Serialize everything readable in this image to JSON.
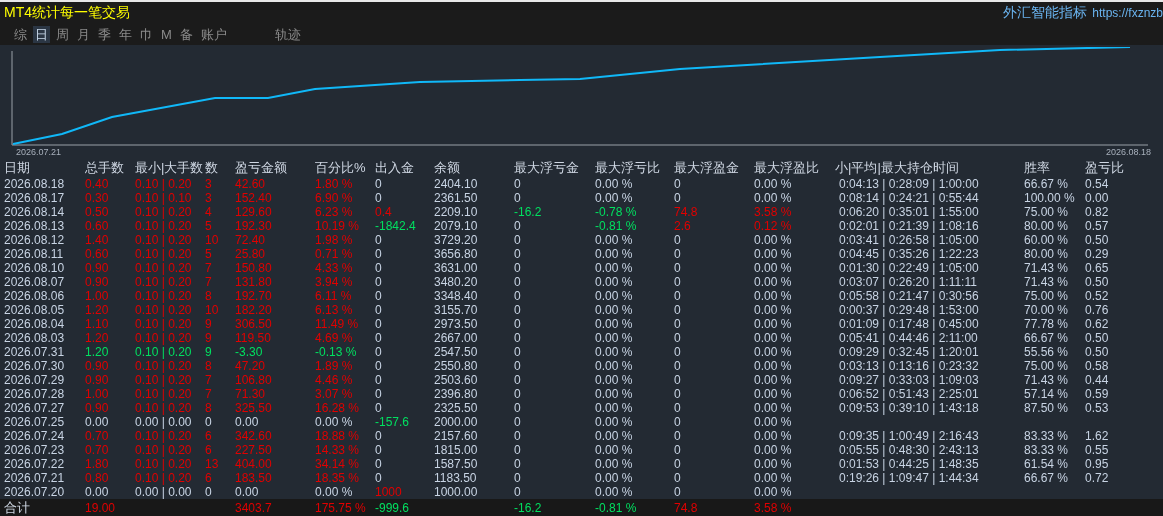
{
  "title": "MT4统计每一笔交易",
  "brand": {
    "name": "外汇智能指标",
    "url": "https://fxznzb"
  },
  "tabs": [
    {
      "label": "综",
      "selected": false
    },
    {
      "label": "日",
      "selected": true
    },
    {
      "label": "周",
      "selected": false
    },
    {
      "label": "月",
      "selected": false
    },
    {
      "label": "季",
      "selected": false
    },
    {
      "label": "年",
      "selected": false
    },
    {
      "label": "巾",
      "selected": false
    },
    {
      "label": "M",
      "selected": false
    },
    {
      "label": "备",
      "selected": false
    },
    {
      "label": "账户",
      "selected": false
    },
    {
      "label": "轨迹",
      "selected": false
    }
  ],
  "chart": {
    "start_label": "2026.07.21",
    "end_label": "2026.08.18"
  },
  "table": {
    "columns": [
      "日期",
      "总手数",
      "最小|大手数",
      "数",
      "盈亏金额",
      "百分比%",
      "出入金",
      "余额",
      "最大浮亏金",
      "最大浮亏比",
      "最大浮盈金",
      "最大浮盈比",
      "小|平均|最大持仓时间",
      "胜率",
      "盈亏比"
    ],
    "rows": [
      {
        "date": "2026.08.18",
        "color": "#e00000",
        "lots": "0.40",
        "lot_range": "0.10 | 0.20",
        "count": "3",
        "profit": "42.60",
        "percent": "1.80 %",
        "cash_flow": {
          "text": "0",
          "color": "#c8d4e4"
        },
        "balance": "2404.10",
        "float_loss": {
          "text": "0",
          "color": "#c8d4e4"
        },
        "float_loss_pct": {
          "text": "0.00 %",
          "color": "#c8d4e4"
        },
        "float_profit": {
          "text": "0",
          "color": "#c8d4e4"
        },
        "float_profit_pct": {
          "text": "0.00 %",
          "color": "#c8d4e4"
        },
        "hold_time": "0:04:13 | 0:28:09 | 1:00:00",
        "win_rate": "66.67 %",
        "pl_ratio": "0.54"
      },
      {
        "date": "2026.08.17",
        "color": "#e00000",
        "lots": "0.30",
        "lot_range": "0.10 | 0.10",
        "count": "3",
        "profit": "152.40",
        "percent": "6.90 %",
        "cash_flow": {
          "text": "0",
          "color": "#c8d4e4"
        },
        "balance": "2361.50",
        "float_loss": {
          "text": "0",
          "color": "#c8d4e4"
        },
        "float_loss_pct": {
          "text": "0.00 %",
          "color": "#c8d4e4"
        },
        "float_profit": {
          "text": "0",
          "color": "#c8d4e4"
        },
        "float_profit_pct": {
          "text": "0.00 %",
          "color": "#c8d4e4"
        },
        "hold_time": "0:08:14 | 0:24:21 | 0:55:44",
        "win_rate": "100.00 %",
        "pl_ratio": "0.00"
      },
      {
        "date": "2026.08.14",
        "color": "#e00000",
        "lots": "0.50",
        "lot_range": "0.10 | 0.20",
        "count": "4",
        "profit": "129.60",
        "percent": "6.23 %",
        "cash_flow": {
          "text": "0.4",
          "color": "#e00000"
        },
        "balance": "2209.10",
        "float_loss": {
          "text": "-16.2",
          "color": "#00e060"
        },
        "float_loss_pct": {
          "text": "-0.78 %",
          "color": "#00e060"
        },
        "float_profit": {
          "text": "74.8",
          "color": "#e00000"
        },
        "float_profit_pct": {
          "text": "3.58 %",
          "color": "#e00000"
        },
        "hold_time": "0:06:20 | 0:35:01 | 1:55:00",
        "win_rate": "75.00 %",
        "pl_ratio": "0.82"
      },
      {
        "date": "2026.08.13",
        "color": "#e00000",
        "lots": "0.60",
        "lot_range": "0.10 | 0.20",
        "count": "5",
        "profit": "192.30",
        "percent": "10.19 %",
        "cash_flow": {
          "text": "-1842.4",
          "color": "#00e060"
        },
        "balance": "2079.10",
        "float_loss": {
          "text": "0",
          "color": "#c8d4e4"
        },
        "float_loss_pct": {
          "text": "-0.81 %",
          "color": "#00e060"
        },
        "float_profit": {
          "text": "2.6",
          "color": "#e00000"
        },
        "float_profit_pct": {
          "text": "0.12 %",
          "color": "#e00000"
        },
        "hold_time": "0:02:01 | 0:21:39 | 1:08:16",
        "win_rate": "80.00 %",
        "pl_ratio": "0.57"
      },
      {
        "date": "2026.08.12",
        "color": "#e00000",
        "lots": "1.40",
        "lot_range": "0.10 | 0.20",
        "count": "10",
        "profit": "72.40",
        "percent": "1.98 %",
        "cash_flow": {
          "text": "0",
          "color": "#c8d4e4"
        },
        "balance": "3729.20",
        "float_loss": {
          "text": "0",
          "color": "#c8d4e4"
        },
        "float_loss_pct": {
          "text": "0.00 %",
          "color": "#c8d4e4"
        },
        "float_profit": {
          "text": "0",
          "color": "#c8d4e4"
        },
        "float_profit_pct": {
          "text": "0.00 %",
          "color": "#c8d4e4"
        },
        "hold_time": "0:03:41 | 0:26:58 | 1:05:00",
        "win_rate": "60.00 %",
        "pl_ratio": "0.50"
      },
      {
        "date": "2026.08.11",
        "color": "#e00000",
        "lots": "0.60",
        "lot_range": "0.10 | 0.20",
        "count": "5",
        "profit": "25.80",
        "percent": "0.71 %",
        "cash_flow": {
          "text": "0",
          "color": "#c8d4e4"
        },
        "balance": "3656.80",
        "float_loss": {
          "text": "0",
          "color": "#c8d4e4"
        },
        "float_loss_pct": {
          "text": "0.00 %",
          "color": "#c8d4e4"
        },
        "float_profit": {
          "text": "0",
          "color": "#c8d4e4"
        },
        "float_profit_pct": {
          "text": "0.00 %",
          "color": "#c8d4e4"
        },
        "hold_time": "0:04:45 | 0:35:26 | 1:22:23",
        "win_rate": "80.00 %",
        "pl_ratio": "0.29"
      },
      {
        "date": "2026.08.10",
        "color": "#e00000",
        "lots": "0.90",
        "lot_range": "0.10 | 0.20",
        "count": "7",
        "profit": "150.80",
        "percent": "4.33 %",
        "cash_flow": {
          "text": "0",
          "color": "#c8d4e4"
        },
        "balance": "3631.00",
        "float_loss": {
          "text": "0",
          "color": "#c8d4e4"
        },
        "float_loss_pct": {
          "text": "0.00 %",
          "color": "#c8d4e4"
        },
        "float_profit": {
          "text": "0",
          "color": "#c8d4e4"
        },
        "float_profit_pct": {
          "text": "0.00 %",
          "color": "#c8d4e4"
        },
        "hold_time": "0:01:30 | 0:22:49 | 1:05:00",
        "win_rate": "71.43 %",
        "pl_ratio": "0.65"
      },
      {
        "date": "2026.08.07",
        "color": "#e00000",
        "lots": "0.90",
        "lot_range": "0.10 | 0.20",
        "count": "7",
        "profit": "131.80",
        "percent": "3.94 %",
        "cash_flow": {
          "text": "0",
          "color": "#c8d4e4"
        },
        "balance": "3480.20",
        "float_loss": {
          "text": "0",
          "color": "#c8d4e4"
        },
        "float_loss_pct": {
          "text": "0.00 %",
          "color": "#c8d4e4"
        },
        "float_profit": {
          "text": "0",
          "color": "#c8d4e4"
        },
        "float_profit_pct": {
          "text": "0.00 %",
          "color": "#c8d4e4"
        },
        "hold_time": "0:03:07 | 0:26:20 | 1:11:11",
        "win_rate": "71.43 %",
        "pl_ratio": "0.50"
      },
      {
        "date": "2026.08.06",
        "color": "#e00000",
        "lots": "1.00",
        "lot_range": "0.10 | 0.20",
        "count": "8",
        "profit": "192.70",
        "percent": "6.11 %",
        "cash_flow": {
          "text": "0",
          "color": "#c8d4e4"
        },
        "balance": "3348.40",
        "float_loss": {
          "text": "0",
          "color": "#c8d4e4"
        },
        "float_loss_pct": {
          "text": "0.00 %",
          "color": "#c8d4e4"
        },
        "float_profit": {
          "text": "0",
          "color": "#c8d4e4"
        },
        "float_profit_pct": {
          "text": "0.00 %",
          "color": "#c8d4e4"
        },
        "hold_time": "0:05:58 | 0:21:47 | 0:30:56",
        "win_rate": "75.00 %",
        "pl_ratio": "0.52"
      },
      {
        "date": "2026.08.05",
        "color": "#e00000",
        "lots": "1.20",
        "lot_range": "0.10 | 0.20",
        "count": "10",
        "profit": "182.20",
        "percent": "6.13 %",
        "cash_flow": {
          "text": "0",
          "color": "#c8d4e4"
        },
        "balance": "3155.70",
        "float_loss": {
          "text": "0",
          "color": "#c8d4e4"
        },
        "float_loss_pct": {
          "text": "0.00 %",
          "color": "#c8d4e4"
        },
        "float_profit": {
          "text": "0",
          "color": "#c8d4e4"
        },
        "float_profit_pct": {
          "text": "0.00 %",
          "color": "#c8d4e4"
        },
        "hold_time": "0:00:37 | 0:29:48 | 1:53:00",
        "win_rate": "70.00 %",
        "pl_ratio": "0.76"
      },
      {
        "date": "2026.08.04",
        "color": "#e00000",
        "lots": "1.10",
        "lot_range": "0.10 | 0.20",
        "count": "9",
        "profit": "306.50",
        "percent": "11.49 %",
        "cash_flow": {
          "text": "0",
          "color": "#c8d4e4"
        },
        "balance": "2973.50",
        "float_loss": {
          "text": "0",
          "color": "#c8d4e4"
        },
        "float_loss_pct": {
          "text": "0.00 %",
          "color": "#c8d4e4"
        },
        "float_profit": {
          "text": "0",
          "color": "#c8d4e4"
        },
        "float_profit_pct": {
          "text": "0.00 %",
          "color": "#c8d4e4"
        },
        "hold_time": "0:01:09 | 0:17:48 | 0:45:00",
        "win_rate": "77.78 %",
        "pl_ratio": "0.62"
      },
      {
        "date": "2026.08.03",
        "color": "#e00000",
        "lots": "1.20",
        "lot_range": "0.10 | 0.20",
        "count": "9",
        "profit": "119.50",
        "percent": "4.69 %",
        "cash_flow": {
          "text": "0",
          "color": "#c8d4e4"
        },
        "balance": "2667.00",
        "float_loss": {
          "text": "0",
          "color": "#c8d4e4"
        },
        "float_loss_pct": {
          "text": "0.00 %",
          "color": "#c8d4e4"
        },
        "float_profit": {
          "text": "0",
          "color": "#c8d4e4"
        },
        "float_profit_pct": {
          "text": "0.00 %",
          "color": "#c8d4e4"
        },
        "hold_time": "0:05:41 | 0:44:46 | 2:11:00",
        "win_rate": "66.67 %",
        "pl_ratio": "0.50"
      },
      {
        "date": "2026.07.31",
        "color": "#00e060",
        "lots": "1.20",
        "lot_range": "0.10 | 0.20",
        "count": "9",
        "profit": "-3.30",
        "percent": "-0.13 %",
        "cash_flow": {
          "text": "0",
          "color": "#c8d4e4"
        },
        "balance": "2547.50",
        "float_loss": {
          "text": "0",
          "color": "#c8d4e4"
        },
        "float_loss_pct": {
          "text": "0.00 %",
          "color": "#c8d4e4"
        },
        "float_profit": {
          "text": "0",
          "color": "#c8d4e4"
        },
        "float_profit_pct": {
          "text": "0.00 %",
          "color": "#c8d4e4"
        },
        "hold_time": "0:09:29 | 0:32:45 | 1:20:01",
        "win_rate": "55.56 %",
        "pl_ratio": "0.50"
      },
      {
        "date": "2026.07.30",
        "color": "#e00000",
        "lots": "0.90",
        "lot_range": "0.10 | 0.20",
        "count": "8",
        "profit": "47.20",
        "percent": "1.89 %",
        "cash_flow": {
          "text": "0",
          "color": "#c8d4e4"
        },
        "balance": "2550.80",
        "float_loss": {
          "text": "0",
          "color": "#c8d4e4"
        },
        "float_loss_pct": {
          "text": "0.00 %",
          "color": "#c8d4e4"
        },
        "float_profit": {
          "text": "0",
          "color": "#c8d4e4"
        },
        "float_profit_pct": {
          "text": "0.00 %",
          "color": "#c8d4e4"
        },
        "hold_time": "0:03:13 | 0:13:16 | 0:23:32",
        "win_rate": "75.00 %",
        "pl_ratio": "0.58"
      },
      {
        "date": "2026.07.29",
        "color": "#e00000",
        "lots": "0.90",
        "lot_range": "0.10 | 0.20",
        "count": "7",
        "profit": "106.80",
        "percent": "4.46 %",
        "cash_flow": {
          "text": "0",
          "color": "#c8d4e4"
        },
        "balance": "2503.60",
        "float_loss": {
          "text": "0",
          "color": "#c8d4e4"
        },
        "float_loss_pct": {
          "text": "0.00 %",
          "color": "#c8d4e4"
        },
        "float_profit": {
          "text": "0",
          "color": "#c8d4e4"
        },
        "float_profit_pct": {
          "text": "0.00 %",
          "color": "#c8d4e4"
        },
        "hold_time": "0:09:27 | 0:33:03 | 1:09:03",
        "win_rate": "71.43 %",
        "pl_ratio": "0.44"
      },
      {
        "date": "2026.07.28",
        "color": "#e00000",
        "lots": "1.00",
        "lot_range": "0.10 | 0.20",
        "count": "7",
        "profit": "71.30",
        "percent": "3.07 %",
        "cash_flow": {
          "text": "0",
          "color": "#c8d4e4"
        },
        "balance": "2396.80",
        "float_loss": {
          "text": "0",
          "color": "#c8d4e4"
        },
        "float_loss_pct": {
          "text": "0.00 %",
          "color": "#c8d4e4"
        },
        "float_profit": {
          "text": "0",
          "color": "#c8d4e4"
        },
        "float_profit_pct": {
          "text": "0.00 %",
          "color": "#c8d4e4"
        },
        "hold_time": "0:06:52 | 0:51:43 | 2:25:01",
        "win_rate": "57.14 %",
        "pl_ratio": "0.59"
      },
      {
        "date": "2026.07.27",
        "color": "#e00000",
        "lots": "0.90",
        "lot_range": "0.10 | 0.20",
        "count": "8",
        "profit": "325.50",
        "percent": "16.28 %",
        "cash_flow": {
          "text": "0",
          "color": "#c8d4e4"
        },
        "balance": "2325.50",
        "float_loss": {
          "text": "0",
          "color": "#c8d4e4"
        },
        "float_loss_pct": {
          "text": "0.00 %",
          "color": "#c8d4e4"
        },
        "float_profit": {
          "text": "0",
          "color": "#c8d4e4"
        },
        "float_profit_pct": {
          "text": "0.00 %",
          "color": "#c8d4e4"
        },
        "hold_time": "0:09:53 | 0:39:10 | 1:43:18",
        "win_rate": "87.50 %",
        "pl_ratio": "0.53"
      },
      {
        "date": "2026.07.25",
        "color": "#c8d4e4",
        "lots": "0.00",
        "lot_range": "0.00 | 0.00",
        "count": "0",
        "profit": "0.00",
        "percent": "0.00 %",
        "cash_flow": {
          "text": "-157.6",
          "color": "#00e060"
        },
        "balance": "2000.00",
        "float_loss": {
          "text": "0",
          "color": "#c8d4e4"
        },
        "float_loss_pct": {
          "text": "0.00 %",
          "color": "#c8d4e4"
        },
        "float_profit": {
          "text": "0",
          "color": "#c8d4e4"
        },
        "float_profit_pct": {
          "text": "0.00 %",
          "color": "#c8d4e4"
        }
      },
      {
        "date": "2026.07.24",
        "color": "#e00000",
        "lots": "0.70",
        "lot_range": "0.10 | 0.20",
        "count": "6",
        "profit": "342.60",
        "percent": "18.88 %",
        "cash_flow": {
          "text": "0",
          "color": "#c8d4e4"
        },
        "balance": "2157.60",
        "float_loss": {
          "text": "0",
          "color": "#c8d4e4"
        },
        "float_loss_pct": {
          "text": "0.00 %",
          "color": "#c8d4e4"
        },
        "float_profit": {
          "text": "0",
          "color": "#c8d4e4"
        },
        "float_profit_pct": {
          "text": "0.00 %",
          "color": "#c8d4e4"
        },
        "hold_time": "0:09:35 | 1:00:49 | 2:16:43",
        "win_rate": "83.33 %",
        "pl_ratio": "1.62"
      },
      {
        "date": "2026.07.23",
        "color": "#e00000",
        "lots": "0.70",
        "lot_range": "0.10 | 0.20",
        "count": "6",
        "profit": "227.50",
        "percent": "14.33 %",
        "cash_flow": {
          "text": "0",
          "color": "#c8d4e4"
        },
        "balance": "1815.00",
        "float_loss": {
          "text": "0",
          "color": "#c8d4e4"
        },
        "float_loss_pct": {
          "text": "0.00 %",
          "color": "#c8d4e4"
        },
        "float_profit": {
          "text": "0",
          "color": "#c8d4e4"
        },
        "float_profit_pct": {
          "text": "0.00 %",
          "color": "#c8d4e4"
        },
        "hold_time": "0:05:55 | 0:48:30 | 2:43:13",
        "win_rate": "83.33 %",
        "pl_ratio": "0.55"
      },
      {
        "date": "2026.07.22",
        "color": "#e00000",
        "lots": "1.80",
        "lot_range": "0.10 | 0.20",
        "count": "13",
        "profit": "404.00",
        "percent": "34.14 %",
        "cash_flow": {
          "text": "0",
          "color": "#c8d4e4"
        },
        "balance": "1587.50",
        "float_loss": {
          "text": "0",
          "color": "#c8d4e4"
        },
        "float_loss_pct": {
          "text": "0.00 %",
          "color": "#c8d4e4"
        },
        "float_profit": {
          "text": "0",
          "color": "#c8d4e4"
        },
        "float_profit_pct": {
          "text": "0.00 %",
          "color": "#c8d4e4"
        },
        "hold_time": "0:01:53 | 0:44:25 | 1:48:35",
        "win_rate": "61.54 %",
        "pl_ratio": "0.95"
      },
      {
        "date": "2026.07.21",
        "color": "#e00000",
        "lots": "0.80",
        "lot_range": "0.10 | 0.20",
        "count": "6",
        "profit": "183.50",
        "percent": "18.35 %",
        "cash_flow": {
          "text": "0",
          "color": "#c8d4e4"
        },
        "balance": "1183.50",
        "float_loss": {
          "text": "0",
          "color": "#c8d4e4"
        },
        "float_loss_pct": {
          "text": "0.00 %",
          "color": "#c8d4e4"
        },
        "float_profit": {
          "text": "0",
          "color": "#c8d4e4"
        },
        "float_profit_pct": {
          "text": "0.00 %",
          "color": "#c8d4e4"
        },
        "hold_time": "0:19:26 | 1:09:47 | 1:44:34",
        "win_rate": "66.67 %",
        "pl_ratio": "0.72"
      },
      {
        "date": "2026.07.20",
        "color": "#c8d4e4",
        "lots": "0.00",
        "lot_range": "0.00 | 0.00",
        "count": "0",
        "profit": "0.00",
        "percent": "0.00 %",
        "cash_flow": {
          "text": "1000",
          "color": "#e00000"
        },
        "balance": "1000.00",
        "float_loss": {
          "text": "0",
          "color": "#c8d4e4"
        },
        "float_loss_pct": {
          "text": "0.00 %",
          "color": "#c8d4e4"
        },
        "float_profit": {
          "text": "0",
          "color": "#c8d4e4"
        },
        "float_profit_pct": {
          "text": "0.00 %",
          "color": "#c8d4e4"
        }
      }
    ],
    "total": {
      "label": "合计",
      "lots": {
        "text": "19.00",
        "color": "#e00000"
      },
      "profit": {
        "text": "3403.7",
        "color": "#e00000"
      },
      "percent": {
        "text": "175.75 %",
        "color": "#e00000"
      },
      "cash_flow": {
        "text": "-999.6",
        "color": "#00e060"
      },
      "float_loss": {
        "text": "-16.2",
        "color": "#00e060"
      },
      "float_loss_pct": {
        "text": "-0.81 %",
        "color": "#00e060"
      },
      "float_profit": {
        "text": "74.8",
        "color": "#e00000"
      },
      "float_profit_pct": {
        "text": "3.58 %",
        "color": "#e00000"
      }
    }
  }
}
